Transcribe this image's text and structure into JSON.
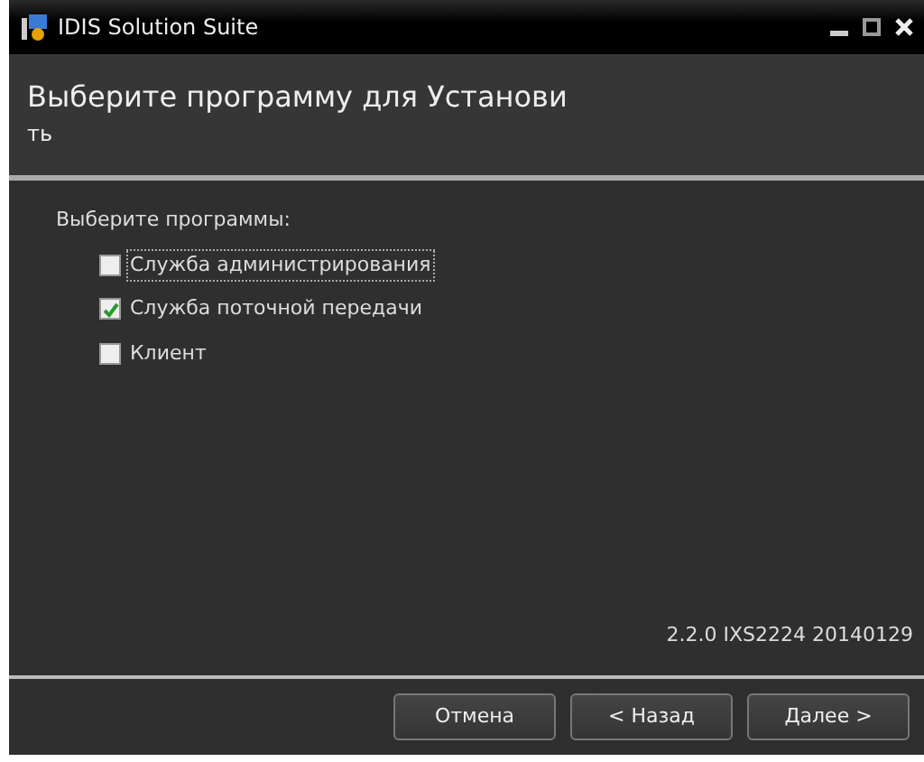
{
  "window": {
    "title": "IDIS Solution Suite"
  },
  "header": {
    "title_lines": [
      "Выберите программу для Установи",
      "ть"
    ]
  },
  "prompt": "Выберите программы:",
  "programs": [
    {
      "label": "Служба администрирования",
      "checked": false,
      "focused": true
    },
    {
      "label": "Служба поточной передачи",
      "checked": true,
      "focused": false
    },
    {
      "label": "Клиент",
      "checked": false,
      "focused": false
    }
  ],
  "version": "2.2.0 IXS2224 20140129",
  "buttons": [
    "Отмена",
    "< Назад",
    "Далее >"
  ]
}
